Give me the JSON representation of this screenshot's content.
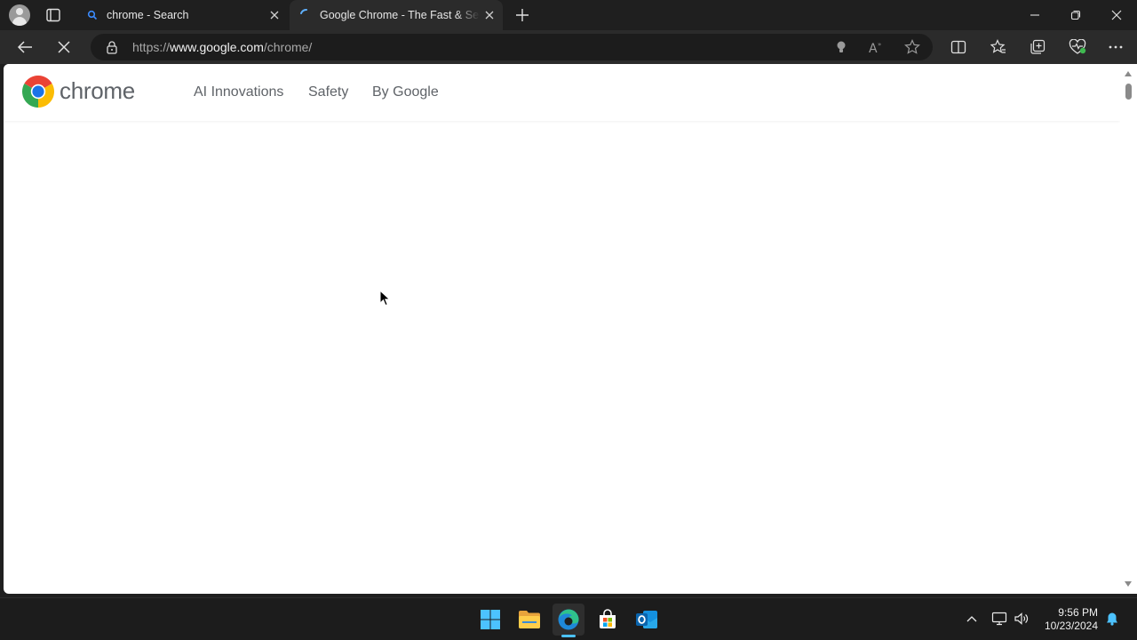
{
  "browser": {
    "tabs": [
      {
        "title": "chrome - Search",
        "active": false
      },
      {
        "title": "Google Chrome - The Fast & Secure Web Browser",
        "active": true
      }
    ],
    "address": {
      "protocol": "https://",
      "host": "www.google.com",
      "path": "/chrome/"
    },
    "icons": {
      "profile": "profile-avatar-icon",
      "tab_actions": "tab-actions-icon",
      "new_tab": "plus-icon",
      "minimize": "minimize-icon",
      "restore": "restore-icon",
      "close": "close-icon",
      "back": "back-arrow-icon",
      "stop": "stop-loading-icon",
      "lock": "lock-icon",
      "read_aloud": "read-aloud-icon",
      "favorite": "star-icon",
      "split_screen": "split-screen-icon",
      "favorites": "favorites-icon",
      "collections": "collections-icon",
      "extension": "browser-essentials-icon",
      "more": "more-icon"
    }
  },
  "page": {
    "brand": "chrome",
    "nav": [
      {
        "label": "AI Innovations"
      },
      {
        "label": "Safety"
      },
      {
        "label": "By Google"
      }
    ]
  },
  "taskbar": {
    "apps": [
      "start-icon",
      "file-explorer-icon",
      "edge-icon",
      "microsoft-store-icon",
      "outlook-icon"
    ],
    "time": "9:56 PM",
    "date": "10/23/2024"
  },
  "colors": {
    "accent": "#4cc2ff",
    "page_text": "#5f6368",
    "chrome_red": "#ea4335",
    "chrome_yellow": "#fbbc04",
    "chrome_green": "#34a853",
    "chrome_blue": "#1a73e8"
  }
}
